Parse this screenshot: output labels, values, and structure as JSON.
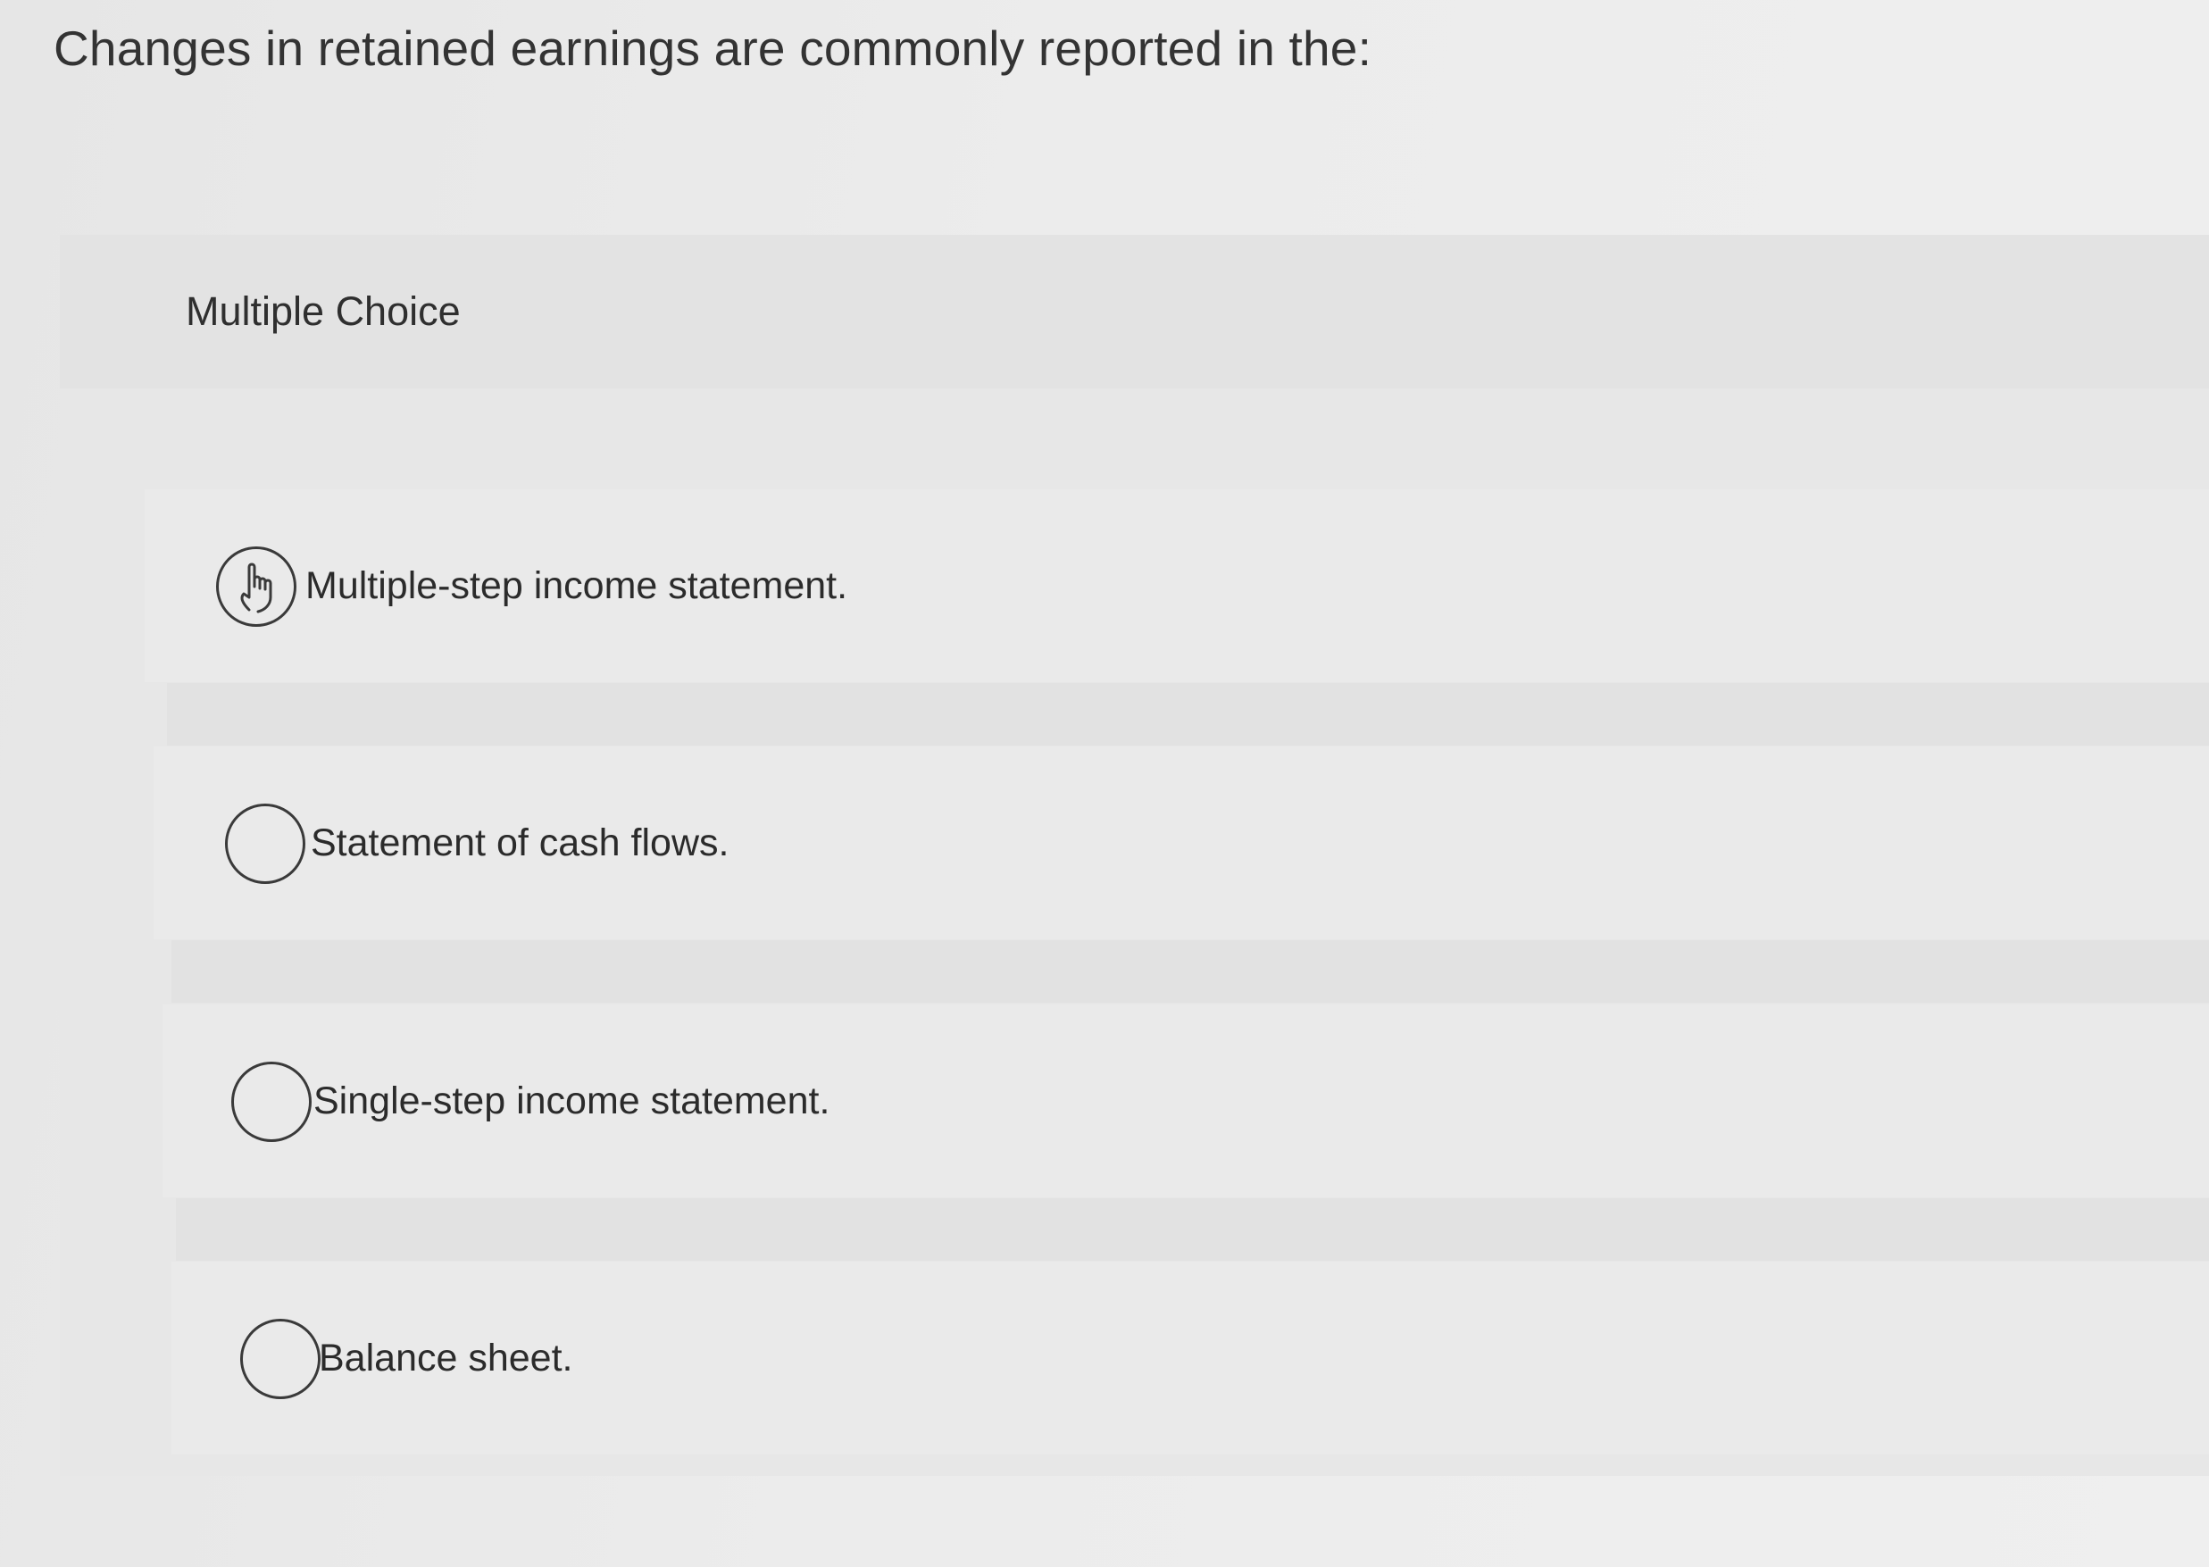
{
  "question": {
    "text": "Changes in retained earnings are commonly reported in the:"
  },
  "panel": {
    "title": "Multiple Choice"
  },
  "options": [
    {
      "label": "Multiple-step income statement.",
      "selected": false,
      "icon": "hand-pointer-icon"
    },
    {
      "label": "Statement of cash flows.",
      "selected": false,
      "icon": "radio-circle-icon"
    },
    {
      "label": "Single-step income statement.",
      "selected": false,
      "icon": "radio-circle-icon"
    },
    {
      "label": "Balance sheet.",
      "selected": false,
      "icon": "radio-circle-icon"
    }
  ],
  "colors": {
    "background": "#ececec",
    "panel": "#e7e7e7",
    "text": "#2b2b2b",
    "radio_border": "#3a3a3a"
  }
}
